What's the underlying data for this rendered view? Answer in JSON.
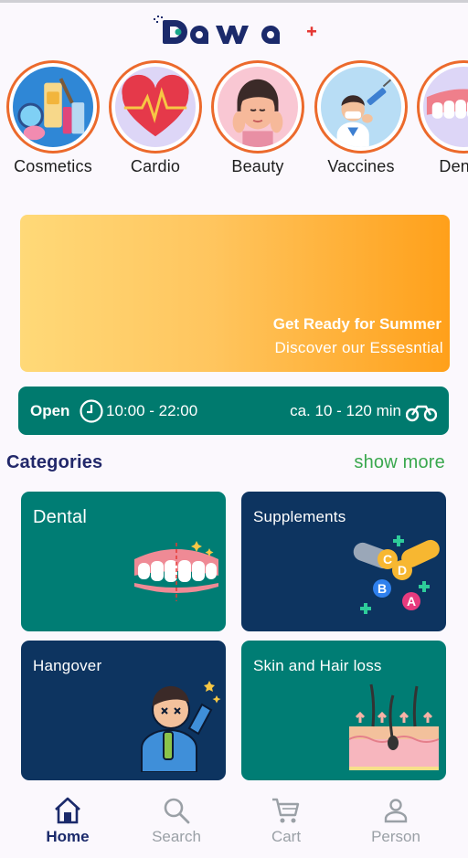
{
  "header": {
    "logo_text": "Dawa",
    "brand_color": "#1b2a6b",
    "accent_color": "#e53935"
  },
  "stories": [
    {
      "label": "Cosmetics",
      "icon": "cosmetics-icon"
    },
    {
      "label": "Cardio",
      "icon": "heart-icon"
    },
    {
      "label": "Beauty",
      "icon": "face-care-icon"
    },
    {
      "label": "Vaccines",
      "icon": "doctor-syringe-icon"
    },
    {
      "label": "Dental",
      "icon": "teeth-icon"
    }
  ],
  "banner": {
    "title": "Get Ready for Summer",
    "subtitle": "Discover our Essesntial"
  },
  "hours_bar": {
    "status": "Open",
    "hours": "10:00 - 22:00",
    "delivery": "ca. 10 - 120 min",
    "bg_color": "#007a6e"
  },
  "categories": {
    "title": "Categories",
    "show_more": "show more",
    "items": [
      {
        "label": "Dental",
        "icon": "teeth-icon"
      },
      {
        "label": "Supplements",
        "icon": "vitamins-icon"
      },
      {
        "label": "Hangover",
        "icon": "dizzy-person-icon"
      },
      {
        "label": "Skin and Hair loss",
        "icon": "skin-layers-icon"
      }
    ]
  },
  "bottom_nav": [
    {
      "label": "Home",
      "icon": "home-icon",
      "active": true
    },
    {
      "label": "Search",
      "icon": "search-icon",
      "active": false
    },
    {
      "label": "Cart",
      "icon": "cart-icon",
      "active": false
    },
    {
      "label": "Person",
      "icon": "person-icon",
      "active": false
    }
  ]
}
